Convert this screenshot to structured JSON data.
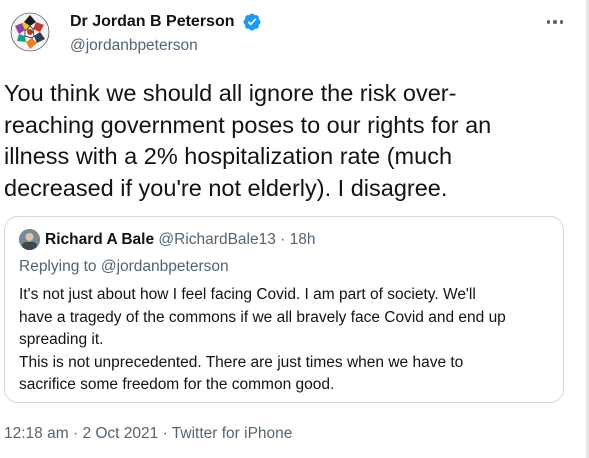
{
  "tweet": {
    "author": {
      "name": "Dr Jordan B Peterson",
      "handle": "@jordanbpeterson",
      "verified": true,
      "avatar_icon": "mosaic-avatar-icon"
    },
    "more_icon": "more-options-icon",
    "text_lines": [
      "You think we should all ignore the risk over-",
      "reaching government poses to our rights for an",
      "illness with a 2% hospitalization rate (much",
      "decreased if you're not elderly). I disagree."
    ],
    "quoted": {
      "name": "Richard A Bale",
      "handle": "@RichardBale13",
      "separator": "·",
      "time": "18h",
      "replying_to": "Replying to @jordanbpeterson",
      "text_lines": [
        "It's not just about how I feel facing Covid.  I am part of society.  We'll",
        "have a tragedy of the commons if we all bravely face Covid and end up",
        "spreading it.",
        "This is not unprecedented.  There are just times when we have to",
        "sacrifice some freedom for the common good."
      ]
    },
    "meta": {
      "time": "12:18 am",
      "separator": "·",
      "date": "2 Oct 2021",
      "source": "Twitter for iPhone"
    }
  },
  "colors": {
    "text_primary": "#0f1419",
    "text_secondary": "#536471",
    "verified_blue": "#1d9bf0",
    "border": "#cfd9de"
  }
}
